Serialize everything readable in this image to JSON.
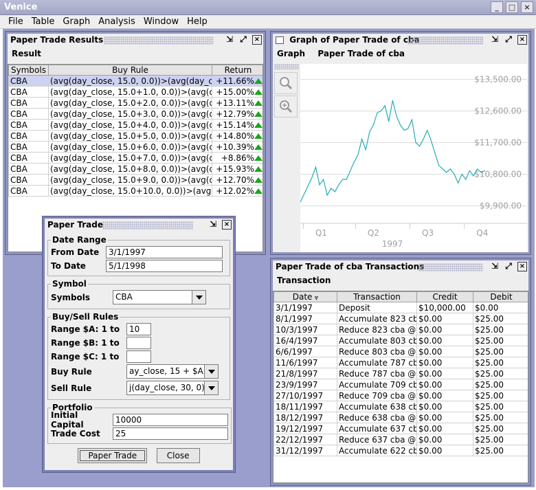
{
  "app": {
    "title": "Venice"
  },
  "menubar": [
    {
      "label": "File",
      "name": "menu-file"
    },
    {
      "label": "Table",
      "name": "menu-table"
    },
    {
      "label": "Graph",
      "name": "menu-graph"
    },
    {
      "label": "Analysis",
      "name": "menu-analysis"
    },
    {
      "label": "Window",
      "name": "menu-window"
    },
    {
      "label": "Help",
      "name": "menu-help"
    }
  ],
  "results": {
    "title": "Paper Trade Results",
    "menu": "Result",
    "columns": [
      "Symbols",
      "Buy Rule",
      "Return"
    ],
    "rows": [
      [
        "CBA",
        "(avg(day_close, 15.0, 0.0))>(avg(day_clo",
        "+11.66%"
      ],
      [
        "CBA",
        "(avg(day_close, 15.0+1.0, 0.0))>(avg(da",
        "+15.00%"
      ],
      [
        "CBA",
        "(avg(day_close, 15.0+2.0, 0.0))>(avg(da",
        "+13.11%"
      ],
      [
        "CBA",
        "(avg(day_close, 15.0+3.0, 0.0))>(avg(da",
        "+12.79%"
      ],
      [
        "CBA",
        "(avg(day_close, 15.0+4.0, 0.0))>(avg(da",
        "+15.14%"
      ],
      [
        "CBA",
        "(avg(day_close, 15.0+5.0, 0.0))>(avg(da",
        "+14.80%"
      ],
      [
        "CBA",
        "(avg(day_close, 15.0+6.0, 0.0))>(avg(da",
        "+10.39%"
      ],
      [
        "CBA",
        "(avg(day_close, 15.0+7.0, 0.0))>(avg(da",
        "+8.86%"
      ],
      [
        "CBA",
        "(avg(day_close, 15.0+8.0, 0.0))>(avg(da",
        "+15.93%"
      ],
      [
        "CBA",
        "(avg(day_close, 15.0+9.0, 0.0))>(avg(da",
        "+12.70%"
      ],
      [
        "CBA",
        "(avg(day_close, 15.0+10.0, 0.0))>(avg(d",
        "+12.02%"
      ]
    ]
  },
  "graph": {
    "title": "Graph of Paper Trade of cba",
    "menu": [
      "Graph",
      "Paper Trade of cba"
    ],
    "tools": [
      "zoom-icon",
      "zoom-in-icon"
    ],
    "line_color": "#21aeb2"
  },
  "chart_data": {
    "type": "line",
    "title": "",
    "xlabel": "1997",
    "ylabel": "",
    "x_ticks": [
      "Q1",
      "Q2",
      "Q3",
      "Q4"
    ],
    "y_ticks": [
      "$13,500.00",
      "$12,600.00",
      "$11,700.00",
      "$10,800.00",
      "$9,900.00"
    ],
    "ylim": [
      9400,
      13900
    ],
    "series": [
      {
        "name": "",
        "x": [
          0,
          0.03,
          0.06,
          0.08,
          0.1,
          0.12,
          0.14,
          0.16,
          0.18,
          0.2,
          0.22,
          0.24,
          0.26,
          0.28,
          0.3,
          0.32,
          0.34,
          0.36,
          0.38,
          0.4,
          0.42,
          0.44,
          0.46,
          0.48,
          0.5,
          0.52,
          0.54,
          0.56,
          0.58,
          0.6,
          0.62,
          0.64,
          0.66,
          0.68,
          0.7,
          0.72,
          0.74,
          0.76,
          0.78,
          0.8,
          0.82,
          0.84,
          0.86,
          0.88,
          0.9,
          0.92,
          0.94,
          0.96
        ],
        "values": [
          10000,
          10350,
          10700,
          11000,
          10500,
          10650,
          10200,
          10400,
          10300,
          10500,
          10650,
          10650,
          10900,
          11150,
          11350,
          11800,
          11500,
          12000,
          12200,
          12550,
          12600,
          12750,
          12300,
          12900,
          12450,
          12200,
          12050,
          12100,
          12350,
          11700,
          11600,
          11800,
          12050,
          11750,
          11400,
          11050,
          10950,
          10850,
          10950,
          10800,
          10550,
          10800,
          10650,
          10900,
          10750,
          10950,
          10850,
          10900
        ]
      }
    ]
  },
  "paper_trade": {
    "title": "Paper Trade",
    "date_range": {
      "legend": "Date Range",
      "from_label": "From Date",
      "from_value": "3/1/1997",
      "to_label": "To Date",
      "to_value": "5/1/1998"
    },
    "symbol": {
      "legend": "Symbol",
      "label": "Symbols",
      "value": "CBA"
    },
    "rules": {
      "legend": "Buy/Sell Rules",
      "range_a_label": "Range $A: 1 to",
      "range_a_value": "10",
      "range_b_label": "Range $B: 1 to",
      "range_b_value": "",
      "range_c_label": "Range $C: 1 to",
      "range_c_value": "",
      "buy_label": "Buy Rule",
      "buy_value": "ay_close, 15 + $A,",
      "sell_label": "Sell Rule",
      "sell_value": "j(day_close, 30, 0)"
    },
    "portfolio": {
      "legend": "Portfolio",
      "capital_label": "Initial Capital",
      "capital_value": "10000",
      "cost_label": "Trade Cost",
      "cost_value": "25"
    },
    "buttons": {
      "paper_trade": "Paper Trade",
      "close": "Close"
    }
  },
  "transactions": {
    "title": "Paper Trade of cba Transactions",
    "menu": "Transaction",
    "columns": [
      "Date",
      "Transaction",
      "Credit",
      "Debit"
    ],
    "rows": [
      [
        "3/1/1997",
        "Deposit",
        "$10,000.00",
        "$0.00"
      ],
      [
        "8/1/1997",
        "Accumulate 823 cb",
        "$0.00",
        "$25.00"
      ],
      [
        "10/3/1997",
        "Reduce 823 cba @",
        "$0.00",
        "$25.00"
      ],
      [
        "16/4/1997",
        "Accumulate 803 cb",
        "$0.00",
        "$25.00"
      ],
      [
        "6/6/1997",
        "Reduce 803 cba @",
        "$0.00",
        "$25.00"
      ],
      [
        "11/6/1997",
        "Accumulate 787 cb",
        "$0.00",
        "$25.00"
      ],
      [
        "21/8/1997",
        "Reduce 787 cba @",
        "$0.00",
        "$25.00"
      ],
      [
        "23/9/1997",
        "Accumulate 709 cb",
        "$0.00",
        "$25.00"
      ],
      [
        "27/10/1997",
        "Reduce 709 cba @",
        "$0.00",
        "$25.00"
      ],
      [
        "18/11/1997",
        "Accumulate 638 cb",
        "$0.00",
        "$25.00"
      ],
      [
        "18/12/1997",
        "Reduce 638 cba @",
        "$0.00",
        "$25.00"
      ],
      [
        "19/12/1997",
        "Accumulate 637 cb",
        "$0.00",
        "$25.00"
      ],
      [
        "22/12/1997",
        "Reduce 637 cba @",
        "$0.00",
        "$25.00"
      ],
      [
        "31/12/1997",
        "Accumulate 622 cb",
        "$0.00",
        "$25.00"
      ]
    ]
  }
}
